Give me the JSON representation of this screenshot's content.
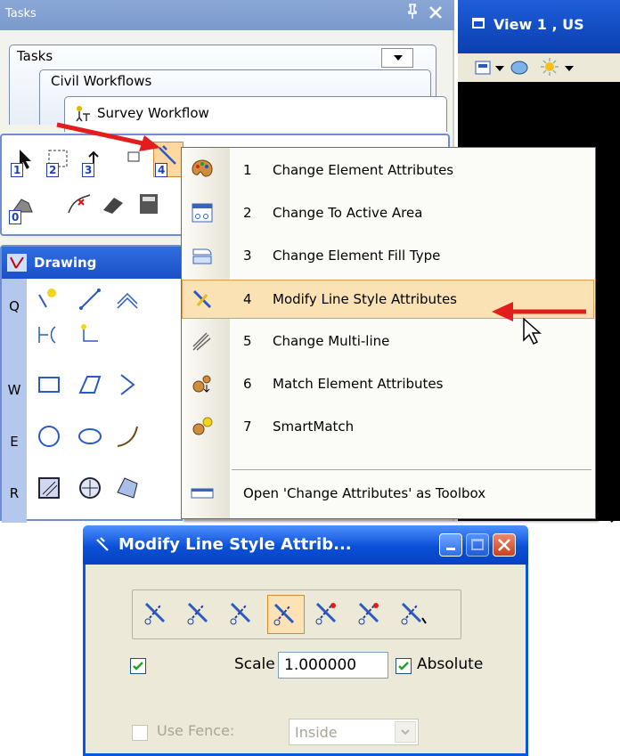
{
  "tasks_panel": {
    "title": "Tasks",
    "pin_glyph": "ᵖ",
    "close_glyph": "✕",
    "tabs": [
      "Tasks",
      "Civil Workflows",
      "Survey Workflow"
    ],
    "tool_numbers": [
      "1",
      "2",
      "3",
      "4",
      "0"
    ],
    "drawing_header": "Drawing",
    "row_labels": [
      "Q",
      "W",
      "E",
      "R"
    ]
  },
  "view_window": {
    "title": "View 1 , US"
  },
  "context_menu": {
    "items": [
      {
        "num": "1",
        "label": "Change Element Attributes",
        "icon": "palette-icon"
      },
      {
        "num": "2",
        "label": "Change To Active Area",
        "icon": "active-area-icon"
      },
      {
        "num": "3",
        "label": "Change Element Fill Type",
        "icon": "fill-type-icon"
      },
      {
        "num": "4",
        "label": "Modify Line Style Attributes",
        "icon": "line-style-icon",
        "highlighted": true
      },
      {
        "num": "5",
        "label": "Change Multi-line",
        "icon": "multiline-icon"
      },
      {
        "num": "6",
        "label": "Match Element Attributes",
        "icon": "match-attributes-icon"
      },
      {
        "num": "7",
        "label": "SmartMatch",
        "icon": "smartmatch-icon"
      }
    ],
    "footer_label": "Open 'Change Attributes' as Toolbox"
  },
  "dialog": {
    "title": "Modify Line Style Attrib...",
    "scale_label": "Scale",
    "scale_value": "1.000000",
    "absolute_label": "Absolute",
    "absolute_checked": true,
    "left_checked": true,
    "use_fence_label": "Use Fence:",
    "fence_mode": "Inside"
  },
  "colors": {
    "xp_blue": "#0a55e3",
    "menu_highlight": "#fbe2b4",
    "arrow_red": "#e31d1d",
    "panel_bg": "#ece9d8"
  }
}
